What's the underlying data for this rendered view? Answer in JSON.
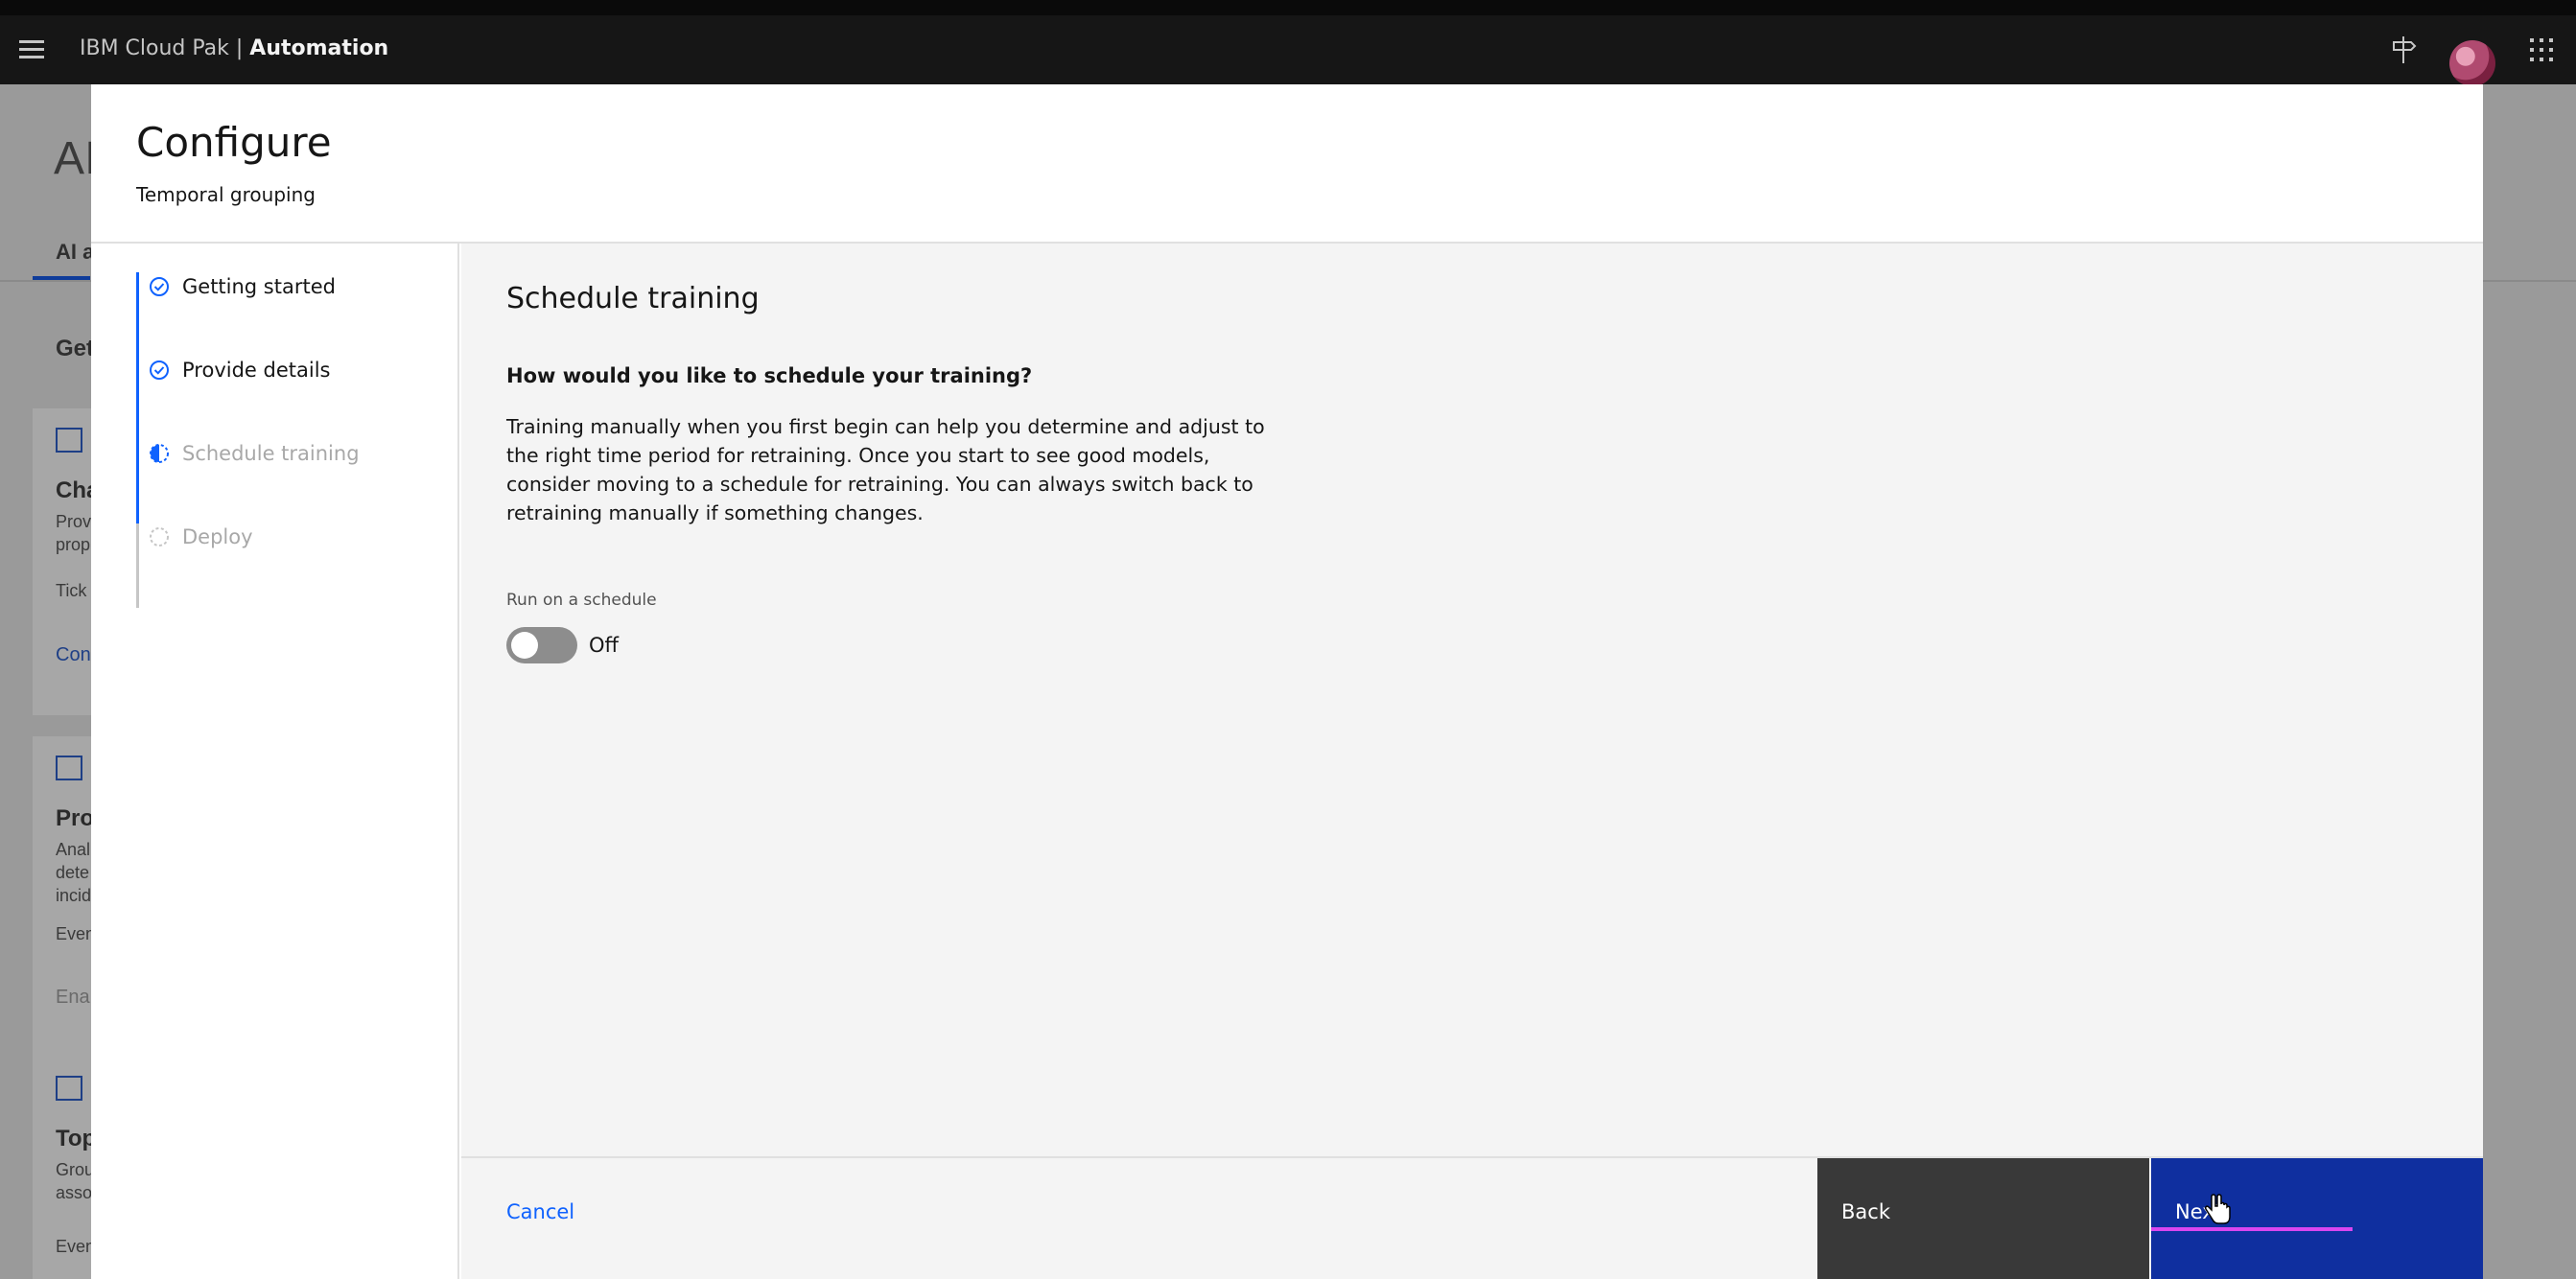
{
  "header": {
    "brand_prefix": "IBM Cloud Pak",
    "brand_separator": " | ",
    "brand_product": "Automation"
  },
  "background_page": {
    "title": "AI",
    "tab": "AI a",
    "section": "Get",
    "cards": [
      {
        "title": "Cha",
        "desc": [
          "Prov",
          "prop"
        ],
        "meta": "Tick",
        "link": "Con"
      },
      {
        "title": "Pro",
        "desc": [
          "Anal",
          "dete",
          "incid"
        ],
        "meta": "Even",
        "field": "Ena"
      },
      {
        "title": "Top",
        "desc": [
          "Grou",
          "asso"
        ],
        "meta": "Even"
      }
    ]
  },
  "modal": {
    "title": "Configure",
    "subtitle": "Temporal grouping",
    "steps": [
      {
        "label": "Getting started",
        "state": "complete"
      },
      {
        "label": "Provide details",
        "state": "complete"
      },
      {
        "label": "Schedule training",
        "state": "current"
      },
      {
        "label": "Deploy",
        "state": "incomplete"
      }
    ],
    "content": {
      "heading": "Schedule training",
      "question": "How would you like to schedule your training?",
      "paragraph": "Training manually when you first begin can help you determine and adjust to the right time period for retraining. Once you start to see good models, consider moving to a schedule for retraining. You can always switch back to retraining manually if something changes.",
      "toggle_label": "Run on a schedule",
      "toggle_state": "Off"
    },
    "footer": {
      "cancel": "Cancel",
      "back": "Back",
      "next": "Next"
    }
  },
  "colors": {
    "primary": "#0f62fe",
    "next_button": "#0f2f9f",
    "back_button": "#393939",
    "header_bg": "#161616"
  }
}
